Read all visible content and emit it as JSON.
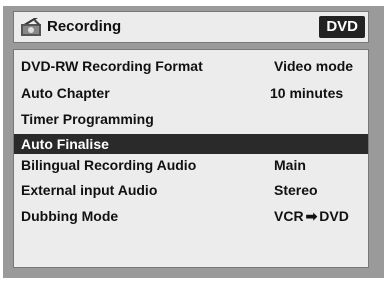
{
  "header": {
    "title": "Recording",
    "badge": "DVD",
    "icon": "recording-icon"
  },
  "menu": {
    "items": [
      {
        "label": "DVD-RW Recording Format",
        "value": "Video mode",
        "selected": false
      },
      {
        "label": "Auto Chapter",
        "value": "10 minutes",
        "selected": false
      },
      {
        "label": "Timer Programming",
        "value": "",
        "selected": false
      },
      {
        "label": "Auto Finalise",
        "value": "",
        "selected": true
      },
      {
        "label": "Bilingual Recording Audio",
        "value": "Main",
        "selected": false
      },
      {
        "label": "External input Audio",
        "value": "Stereo",
        "selected": false
      },
      {
        "label": "Dubbing Mode",
        "value_from": "VCR",
        "value_to": "DVD",
        "selected": false
      }
    ]
  },
  "colors": {
    "frame": "#9a9a9a",
    "panel": "#ececec",
    "selected_row": "#2a2a2a",
    "badge": "#222222"
  }
}
